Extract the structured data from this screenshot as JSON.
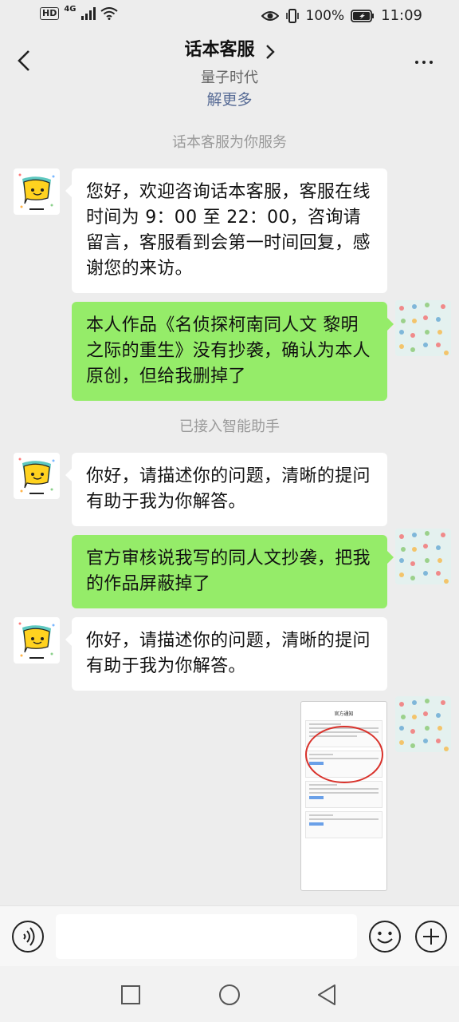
{
  "status_bar": {
    "hd": "HD",
    "network": "4G",
    "battery": "100%",
    "time": "11:09"
  },
  "header": {
    "title": "话本客服",
    "subtitle": "量子时代",
    "learn_more": "解更多"
  },
  "messages": {
    "service_note": "话本客服为你服务",
    "bot_welcome": "您好，欢迎咨询话本客服，客服在线时间为 9：00 至 22：00，咨询请留言，客服看到会第一时间回复，感谢您的来访。",
    "user_1": "本人作品《名侦探柯南同人文 黎明之际的重生》没有抄袭，确认为本人原创，但给我删掉了",
    "assistant_note": "已接入智能助手",
    "bot_reply_1": "你好，请描述你的问题，清晰的提问有助于我为你解答。",
    "user_2": "官方审核说我写的同人文抄袭，把我的作品屏蔽掉了",
    "bot_reply_2": "你好，请描述你的问题，清晰的提问有助于我为你解答。"
  },
  "image_message": {
    "title": "官方通知"
  },
  "input": {
    "placeholder": ""
  },
  "colors": {
    "user_bubble": "#95ec69",
    "bot_bubble": "#ffffff",
    "background": "#ededed",
    "link": "#576b95"
  },
  "icons": [
    "signal-icon",
    "wifi-icon",
    "eye-icon",
    "vibrate-icon",
    "battery-icon",
    "back-arrow-icon",
    "chevron-right-icon",
    "more-icon",
    "voice-icon",
    "emoji-icon",
    "plus-icon",
    "nav-recent-icon",
    "nav-home-icon",
    "nav-back-icon"
  ]
}
